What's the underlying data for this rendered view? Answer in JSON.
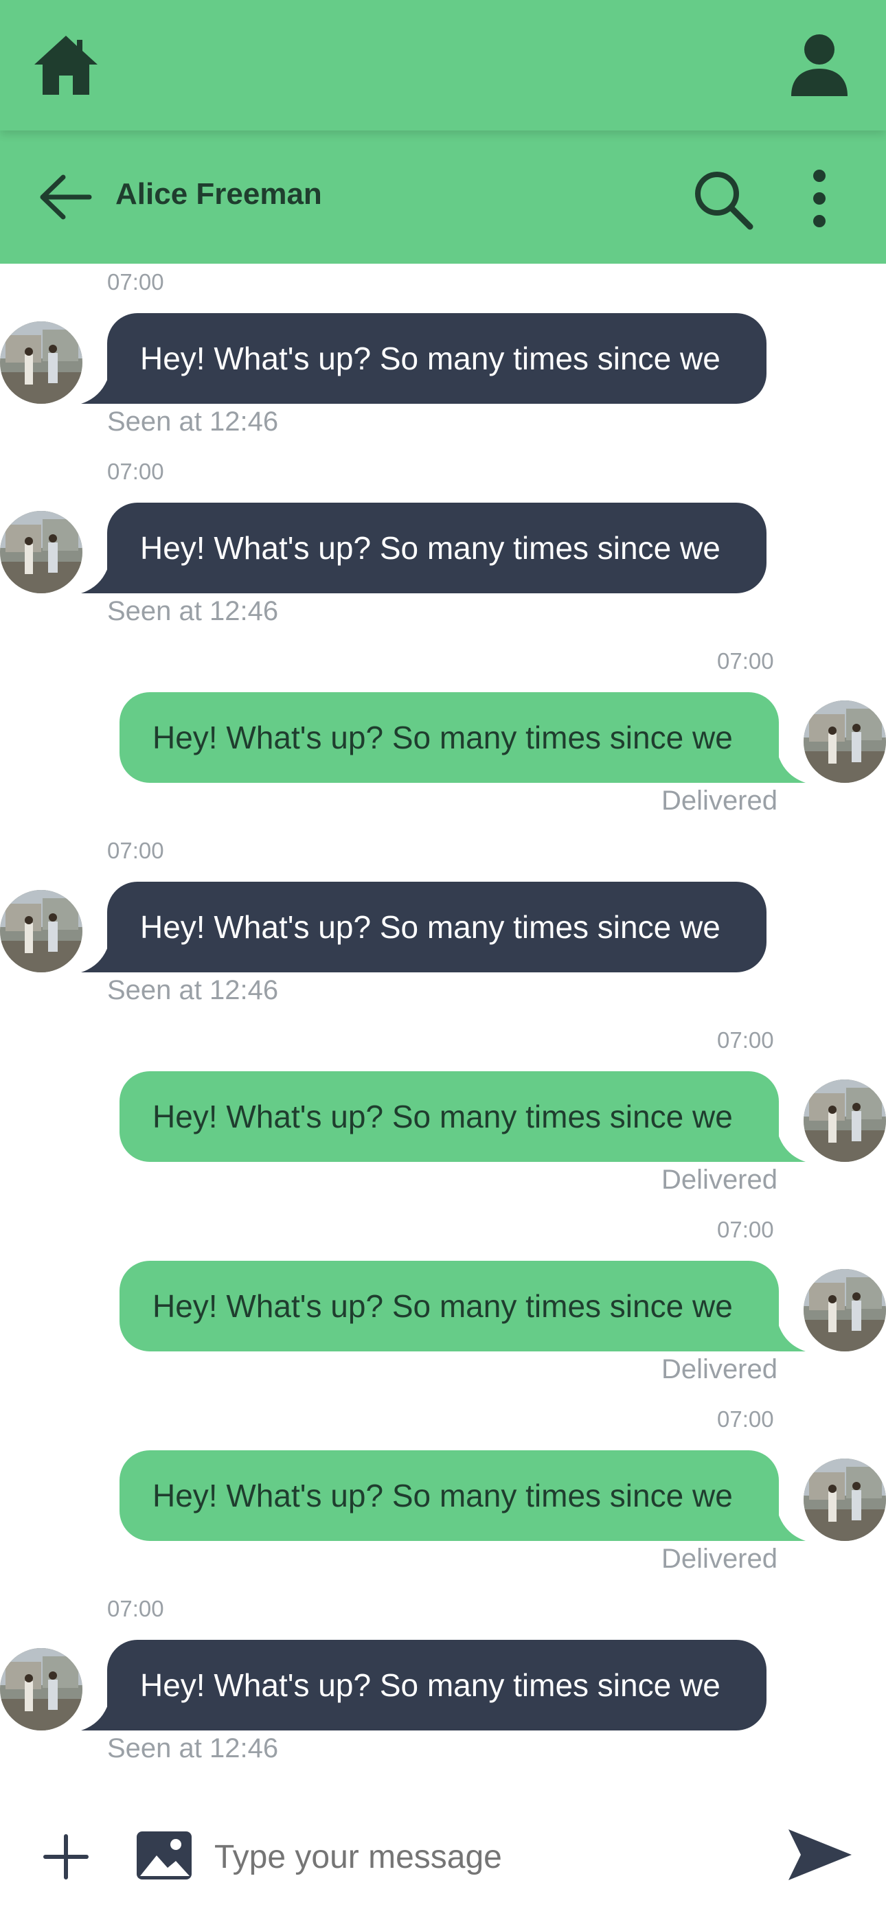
{
  "header": {
    "icons": {
      "home": "home-icon",
      "user": "user-icon"
    }
  },
  "chat": {
    "contact_name": "Alice Freeman",
    "icons": {
      "back": "arrow-left-icon",
      "search": "search-icon",
      "more": "more-vertical-icon"
    }
  },
  "messages": [
    {
      "direction": "incoming",
      "time": "07:00",
      "text": "Hey! What's up? So many times since we",
      "status": "Seen at 12:46"
    },
    {
      "direction": "incoming",
      "time": "07:00",
      "text": "Hey! What's up? So many times since we",
      "status": "Seen at 12:46"
    },
    {
      "direction": "outgoing",
      "time": "07:00",
      "text": "Hey! What's up? So many times since we",
      "status": "Delivered"
    },
    {
      "direction": "incoming",
      "time": "07:00",
      "text": "Hey! What's up? So many times since we",
      "status": "Seen at 12:46"
    },
    {
      "direction": "outgoing",
      "time": "07:00",
      "text": "Hey! What's up? So many times since we",
      "status": "Delivered"
    },
    {
      "direction": "outgoing",
      "time": "07:00",
      "text": "Hey! What's up? So many times since we",
      "status": "Delivered"
    },
    {
      "direction": "outgoing",
      "time": "07:00",
      "text": "Hey! What's up? So many times since we",
      "status": "Delivered"
    },
    {
      "direction": "incoming",
      "time": "07:00",
      "text": "Hey! What's up? So many times since we",
      "status": "Seen at 12:46"
    }
  ],
  "composer": {
    "placeholder": "Type your message",
    "value": "",
    "icons": {
      "add": "plus-icon",
      "image": "image-icon",
      "send": "send-icon"
    }
  },
  "colors": {
    "accent": "#66cc88",
    "incoming_bubble": "#343d4f",
    "dark_text": "#1f3d2e",
    "muted_text": "#9aa0a6"
  }
}
